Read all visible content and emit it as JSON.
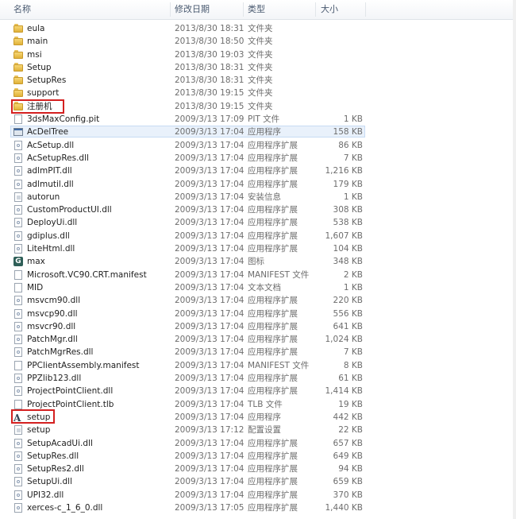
{
  "columns": {
    "name": "名称",
    "date": "修改日期",
    "type": "类型",
    "size": "大小"
  },
  "files": [
    {
      "name": "eula",
      "date": "2013/8/30 18:31",
      "type": "文件夹",
      "size": "",
      "icon": "folder-icon"
    },
    {
      "name": "main",
      "date": "2013/8/30 18:50",
      "type": "文件夹",
      "size": "",
      "icon": "folder-icon"
    },
    {
      "name": "msi",
      "date": "2013/8/30 19:03",
      "type": "文件夹",
      "size": "",
      "icon": "folder-icon"
    },
    {
      "name": "Setup",
      "date": "2013/8/30 18:31",
      "type": "文件夹",
      "size": "",
      "icon": "folder-icon"
    },
    {
      "name": "SetupRes",
      "date": "2013/8/30 18:31",
      "type": "文件夹",
      "size": "",
      "icon": "folder-icon"
    },
    {
      "name": "support",
      "date": "2013/8/30 19:15",
      "type": "文件夹",
      "size": "",
      "icon": "folder-icon"
    },
    {
      "name": "注册机",
      "date": "2013/8/30 19:15",
      "type": "文件夹",
      "size": "",
      "icon": "folder-icon"
    },
    {
      "name": "3dsMaxConfig.pit",
      "date": "2009/3/13 17:09",
      "type": "PIT 文件",
      "size": "1 KB",
      "icon": "file-icon"
    },
    {
      "name": "AcDelTree",
      "date": "2009/3/13 17:04",
      "type": "应用程序",
      "size": "158 KB",
      "icon": "exe-icon"
    },
    {
      "name": "AcSetup.dll",
      "date": "2009/3/13 17:04",
      "type": "应用程序扩展",
      "size": "86 KB",
      "icon": "dll-icon"
    },
    {
      "name": "AcSetupRes.dll",
      "date": "2009/3/13 17:04",
      "type": "应用程序扩展",
      "size": "7 KB",
      "icon": "dll-icon"
    },
    {
      "name": "adlmPIT.dll",
      "date": "2009/3/13 17:04",
      "type": "应用程序扩展",
      "size": "1,216 KB",
      "icon": "dll-icon"
    },
    {
      "name": "adlmutil.dll",
      "date": "2009/3/13 17:04",
      "type": "应用程序扩展",
      "size": "179 KB",
      "icon": "dll-icon"
    },
    {
      "name": "autorun",
      "date": "2009/3/13 17:04",
      "type": "安装信息",
      "size": "1 KB",
      "icon": "inf-icon"
    },
    {
      "name": "CustomProductUI.dll",
      "date": "2009/3/13 17:04",
      "type": "应用程序扩展",
      "size": "308 KB",
      "icon": "dll-icon"
    },
    {
      "name": "DeployUi.dll",
      "date": "2009/3/13 17:04",
      "type": "应用程序扩展",
      "size": "538 KB",
      "icon": "dll-icon"
    },
    {
      "name": "gdiplus.dll",
      "date": "2009/3/13 17:04",
      "type": "应用程序扩展",
      "size": "1,607 KB",
      "icon": "dll-icon"
    },
    {
      "name": "LiteHtml.dll",
      "date": "2009/3/13 17:04",
      "type": "应用程序扩展",
      "size": "104 KB",
      "icon": "dll-icon"
    },
    {
      "name": "max",
      "date": "2009/3/13 17:04",
      "type": "图标",
      "size": "348 KB",
      "icon": "max-icon"
    },
    {
      "name": "Microsoft.VC90.CRT.manifest",
      "date": "2009/3/13 17:04",
      "type": "MANIFEST 文件",
      "size": "2 KB",
      "icon": "file-icon"
    },
    {
      "name": "MID",
      "date": "2009/3/13 17:04",
      "type": "文本文档",
      "size": "1 KB",
      "icon": "file-icon"
    },
    {
      "name": "msvcm90.dll",
      "date": "2009/3/13 17:04",
      "type": "应用程序扩展",
      "size": "220 KB",
      "icon": "dll-icon"
    },
    {
      "name": "msvcp90.dll",
      "date": "2009/3/13 17:04",
      "type": "应用程序扩展",
      "size": "556 KB",
      "icon": "dll-icon"
    },
    {
      "name": "msvcr90.dll",
      "date": "2009/3/13 17:04",
      "type": "应用程序扩展",
      "size": "641 KB",
      "icon": "dll-icon"
    },
    {
      "name": "PatchMgr.dll",
      "date": "2009/3/13 17:04",
      "type": "应用程序扩展",
      "size": "1,024 KB",
      "icon": "dll-icon"
    },
    {
      "name": "PatchMgrRes.dll",
      "date": "2009/3/13 17:04",
      "type": "应用程序扩展",
      "size": "7 KB",
      "icon": "dll-icon"
    },
    {
      "name": "PPClientAssembly.manifest",
      "date": "2009/3/13 17:04",
      "type": "MANIFEST 文件",
      "size": "8 KB",
      "icon": "file-icon"
    },
    {
      "name": "PPZlib123.dll",
      "date": "2009/3/13 17:04",
      "type": "应用程序扩展",
      "size": "61 KB",
      "icon": "dll-icon"
    },
    {
      "name": "ProjectPointClient.dll",
      "date": "2009/3/13 17:04",
      "type": "应用程序扩展",
      "size": "1,414 KB",
      "icon": "dll-icon"
    },
    {
      "name": "ProjectPointClient.tlb",
      "date": "2009/3/13 17:04",
      "type": "TLB 文件",
      "size": "19 KB",
      "icon": "file-icon"
    },
    {
      "name": "setup",
      "date": "2009/3/13 17:04",
      "type": "应用程序",
      "size": "442 KB",
      "icon": "setup-icon"
    },
    {
      "name": "setup",
      "date": "2009/3/13 17:12",
      "type": "配置设置",
      "size": "22 KB",
      "icon": "inf-icon"
    },
    {
      "name": "SetupAcadUi.dll",
      "date": "2009/3/13 17:04",
      "type": "应用程序扩展",
      "size": "657 KB",
      "icon": "dll-icon"
    },
    {
      "name": "SetupRes.dll",
      "date": "2009/3/13 17:04",
      "type": "应用程序扩展",
      "size": "649 KB",
      "icon": "dll-icon"
    },
    {
      "name": "SetupRes2.dll",
      "date": "2009/3/13 17:04",
      "type": "应用程序扩展",
      "size": "94 KB",
      "icon": "dll-icon"
    },
    {
      "name": "SetupUi.dll",
      "date": "2009/3/13 17:04",
      "type": "应用程序扩展",
      "size": "659 KB",
      "icon": "dll-icon"
    },
    {
      "name": "UPI32.dll",
      "date": "2009/3/13 17:04",
      "type": "应用程序扩展",
      "size": "370 KB",
      "icon": "dll-icon"
    },
    {
      "name": "xerces-c_1_6_0.dll",
      "date": "2009/3/13 17:05",
      "type": "应用程序扩展",
      "size": "1,440 KB",
      "icon": "dll-icon"
    }
  ],
  "selected_index": 8,
  "highlighted": [
    "注册机",
    "setup"
  ],
  "colors": {
    "highlight_border": "#d42020",
    "selection_bg": "#e9f1fb",
    "folder": "#e8c15a"
  }
}
